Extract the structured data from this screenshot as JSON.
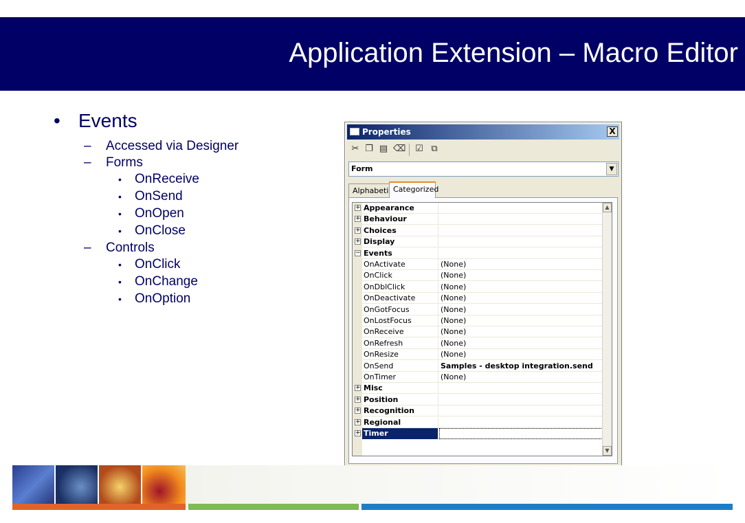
{
  "slide": {
    "title": "Application Extension – Macro Editor",
    "bullets": {
      "main": "Events",
      "items": [
        {
          "text": "Accessed via Designer"
        },
        {
          "text": "Forms",
          "children": [
            "OnReceive",
            "OnSend",
            "OnOpen",
            "OnClose"
          ]
        },
        {
          "text": "Controls",
          "children": [
            "OnClick",
            "OnChange",
            "OnOption"
          ]
        }
      ]
    },
    "colors": {
      "banner": "#000066",
      "text": "#000066",
      "bar_orange": "#e2632a",
      "bar_green": "#7dbb55",
      "bar_blue": "#1d7dc7"
    }
  },
  "properties_window": {
    "title": "Properties",
    "close_label": "X",
    "toolbar": [
      "cut-icon",
      "copy-icon",
      "paste-icon",
      "eraser-icon",
      "checkbox-icon",
      "layers-icon"
    ],
    "object_selector": {
      "value": "Form"
    },
    "tabs": [
      {
        "label": "Alphabetic",
        "active": false
      },
      {
        "label": "Categorized",
        "active": true
      }
    ],
    "rows": [
      {
        "kind": "category",
        "name": "Appearance",
        "expander": "+"
      },
      {
        "kind": "category",
        "name": "Behaviour",
        "expander": "+"
      },
      {
        "kind": "category",
        "name": "Choices",
        "expander": "+"
      },
      {
        "kind": "category",
        "name": "Display",
        "expander": "+"
      },
      {
        "kind": "category",
        "name": "Events",
        "expander": "−"
      },
      {
        "kind": "property",
        "name": "OnActivate",
        "value": "(None)"
      },
      {
        "kind": "property",
        "name": "OnClick",
        "value": "(None)"
      },
      {
        "kind": "property",
        "name": "OnDblClick",
        "value": "(None)"
      },
      {
        "kind": "property",
        "name": "OnDeactivate",
        "value": "(None)"
      },
      {
        "kind": "property",
        "name": "OnGotFocus",
        "value": "(None)"
      },
      {
        "kind": "property",
        "name": "OnLostFocus",
        "value": "(None)"
      },
      {
        "kind": "property",
        "name": "OnReceive",
        "value": "(None)"
      },
      {
        "kind": "property",
        "name": "OnRefresh",
        "value": "(None)"
      },
      {
        "kind": "property",
        "name": "OnResize",
        "value": "(None)"
      },
      {
        "kind": "property",
        "name": "OnSend",
        "value": "Samples - desktop integration.send",
        "bold": true
      },
      {
        "kind": "property",
        "name": "OnTimer",
        "value": "(None)"
      },
      {
        "kind": "category",
        "name": "Misc",
        "expander": "+"
      },
      {
        "kind": "category",
        "name": "Position",
        "expander": "+"
      },
      {
        "kind": "category",
        "name": "Recognition",
        "expander": "+"
      },
      {
        "kind": "category",
        "name": "Regional",
        "expander": "+"
      },
      {
        "kind": "category",
        "name": "Timer",
        "expander": "+",
        "selected": true
      }
    ]
  }
}
